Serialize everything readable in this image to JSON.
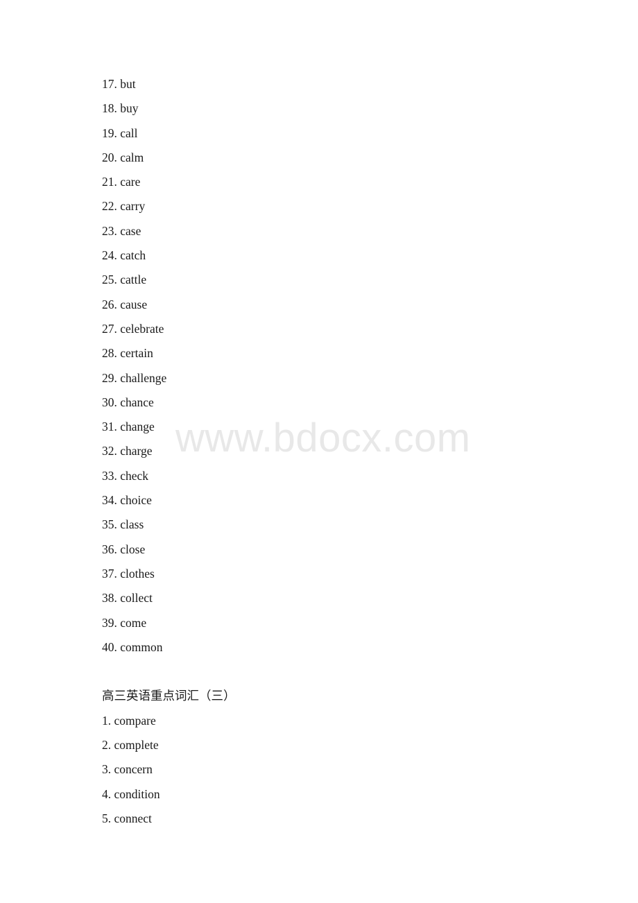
{
  "document": {
    "background_color": "#ffffff",
    "text_color": "#1a1a1a",
    "watermark": {
      "text": "www.bdocx.com",
      "color": "#e8e8e8"
    }
  },
  "sections": [
    {
      "id": "continued-list",
      "heading": null,
      "items": [
        {
          "number": "17.",
          "word": "but",
          "line": "17. but"
        },
        {
          "number": "18.",
          "word": "buy",
          "line": "18. buy"
        },
        {
          "number": "19.",
          "word": "call",
          "line": "19. call"
        },
        {
          "number": "20.",
          "word": "calm",
          "line": "20. calm"
        },
        {
          "number": "21.",
          "word": "care",
          "line": "21. care"
        },
        {
          "number": "22.",
          "word": "carry",
          "line": "22. carry"
        },
        {
          "number": "23.",
          "word": "case",
          "line": "23. case"
        },
        {
          "number": "24.",
          "word": "catch",
          "line": "24. catch"
        },
        {
          "number": "25.",
          "word": "cattle",
          "line": "25. cattle"
        },
        {
          "number": "26.",
          "word": "cause",
          "line": "26. cause"
        },
        {
          "number": "27.",
          "word": "celebrate",
          "line": "27. celebrate"
        },
        {
          "number": "28.",
          "word": "certain",
          "line": "28. certain"
        },
        {
          "number": "29.",
          "word": "challenge",
          "line": "29. challenge"
        },
        {
          "number": "30.",
          "word": "chance",
          "line": "30. chance"
        },
        {
          "number": "31.",
          "word": "change",
          "line": "31. change"
        },
        {
          "number": "32.",
          "word": "charge",
          "line": "32. charge"
        },
        {
          "number": "33.",
          "word": "check",
          "line": "33. check"
        },
        {
          "number": "34.",
          "word": "choice",
          "line": "34. choice"
        },
        {
          "number": "35.",
          "word": "class",
          "line": "35. class"
        },
        {
          "number": "36.",
          "word": "close",
          "line": "36. close"
        },
        {
          "number": "37.",
          "word": "clothes",
          "line": "37. clothes"
        },
        {
          "number": "38.",
          "word": "collect",
          "line": "38. collect"
        },
        {
          "number": "39.",
          "word": "come",
          "line": "39. come"
        },
        {
          "number": "40.",
          "word": "common",
          "line": "40. common"
        }
      ]
    },
    {
      "id": "new-list",
      "heading": "高三英语重点词汇（三）",
      "items": [
        {
          "number": "1.",
          "word": "compare",
          "line": "1. compare"
        },
        {
          "number": "2.",
          "word": "complete",
          "line": "2. complete"
        },
        {
          "number": "3.",
          "word": "concern",
          "line": "3. concern"
        },
        {
          "number": "4.",
          "word": "condition",
          "line": "4. condition"
        },
        {
          "number": "5.",
          "word": "connect",
          "line": "5. connect"
        }
      ]
    }
  ]
}
